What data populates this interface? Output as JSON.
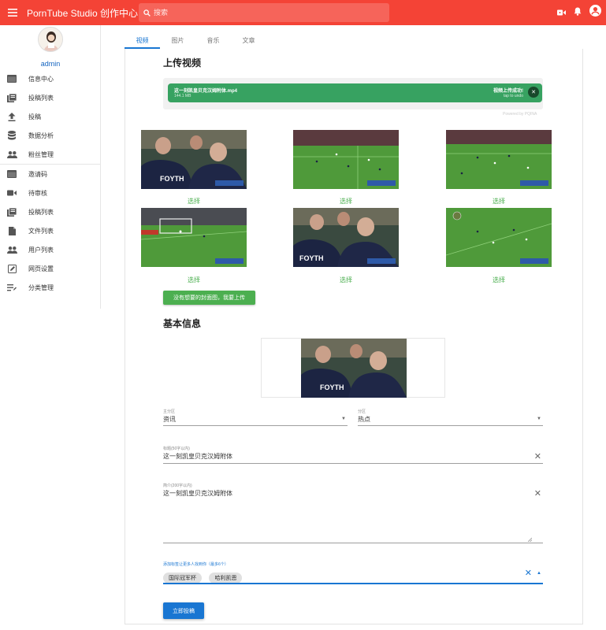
{
  "header": {
    "brand": "PornTube Studio 创作中心",
    "search_placeholder": "搜索",
    "bg_color": "#f44336",
    "icons": [
      "menu-icon",
      "search-icon",
      "video-camera-icon",
      "bell-icon",
      "account-icon"
    ]
  },
  "sidebar": {
    "username": "admin",
    "group1": [
      {
        "label": "信息中心",
        "icon": "dashboard-icon"
      },
      {
        "label": "投稿列表",
        "icon": "library-icon"
      },
      {
        "label": "投稿",
        "icon": "upload-icon"
      },
      {
        "label": "数据分析",
        "icon": "database-icon"
      },
      {
        "label": "粉丝管理",
        "icon": "people-icon"
      }
    ],
    "group2": [
      {
        "label": "邀请码",
        "icon": "card-icon"
      },
      {
        "label": "待审核",
        "icon": "video-icon"
      },
      {
        "label": "投稿列表",
        "icon": "library-icon"
      },
      {
        "label": "文件列表",
        "icon": "file-icon"
      },
      {
        "label": "用户列表",
        "icon": "people-icon"
      },
      {
        "label": "网页设置",
        "icon": "edit-icon"
      },
      {
        "label": "分类管理",
        "icon": "sort-icon"
      }
    ]
  },
  "tabs": [
    {
      "label": "视频",
      "active": true
    },
    {
      "label": "图片",
      "active": false
    },
    {
      "label": "音乐",
      "active": false
    },
    {
      "label": "文章",
      "active": false
    }
  ],
  "upload": {
    "title": "上传视频",
    "filename": "这一刻凯皇贝克汉姆附体.mp4",
    "filesize": "144.1 MB",
    "status": "视频上传成功!",
    "undo": "tap to undo",
    "powered": "Powered by PQINA",
    "progress_color": "#37a261"
  },
  "covers": {
    "pick_label": "选择",
    "upload_label": "没有想要的封面图，我要上传",
    "accent": "#4caf50"
  },
  "info": {
    "title": "基本信息",
    "main_category": {
      "label": "主分区",
      "value": "资讯"
    },
    "sub_category": {
      "label": "分区",
      "value": "热点"
    },
    "title_field": {
      "label": "标题(50字以内)",
      "value": "这一刻凯皇贝克汉姆附体"
    },
    "intro_field": {
      "label": "简介(200字以内)",
      "value": "这一刻凯皇贝克汉姆附体"
    },
    "tags": {
      "label": "添加标签让更多人找到你（最多6个）",
      "values": [
        "国际冠军杯",
        "哈利凯恩"
      ]
    },
    "submit_label": "立即投稿",
    "submit_color": "#1976d2"
  }
}
